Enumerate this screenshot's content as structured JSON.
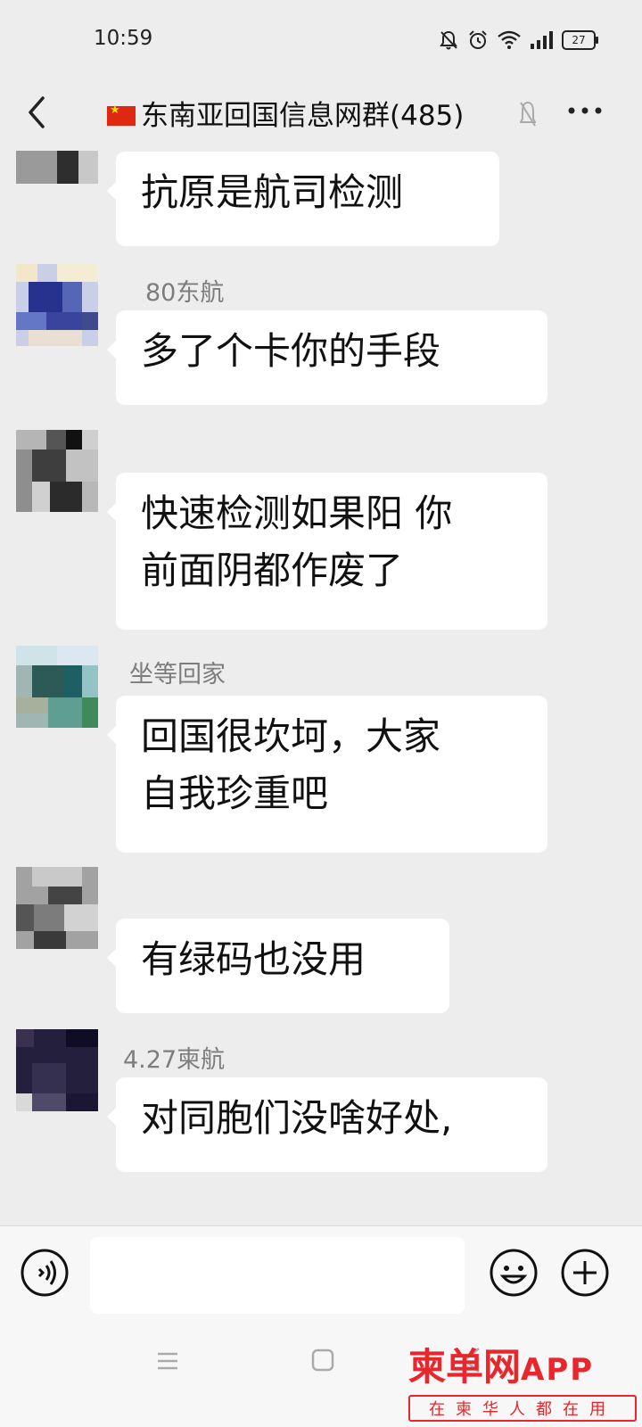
{
  "status_bar": {
    "time": "10:59",
    "battery": "27"
  },
  "header": {
    "title": "东南亚回国信息网群(485)"
  },
  "messages": [
    {
      "sender": "",
      "lines": [
        "抗原是航司检测"
      ]
    },
    {
      "sender": "80东航",
      "lines": [
        "多了个卡你的手段"
      ]
    },
    {
      "sender": "",
      "lines": [
        "快速检测如果阳 你",
        "前面阴都作废了"
      ]
    },
    {
      "sender": "坐等回家",
      "lines": [
        "回国很坎坷，大家",
        "自我珍重吧"
      ]
    },
    {
      "sender": "",
      "lines": [
        "有绿码也没用"
      ]
    },
    {
      "sender": "4.27柬航",
      "lines": [
        "对同胞们没啥好处,"
      ]
    }
  ],
  "input_bar": {
    "voice_icon": "voice-icon",
    "emoji_icon": "emoji-icon",
    "plus_icon": "plus-icon"
  },
  "watermark": {
    "brand": "柬单网",
    "app": "APP",
    "slogan": "在柬华人都在用"
  },
  "colors": {
    "background": "#ededed",
    "bubble": "#ffffff",
    "watermark": "#e8262b"
  }
}
